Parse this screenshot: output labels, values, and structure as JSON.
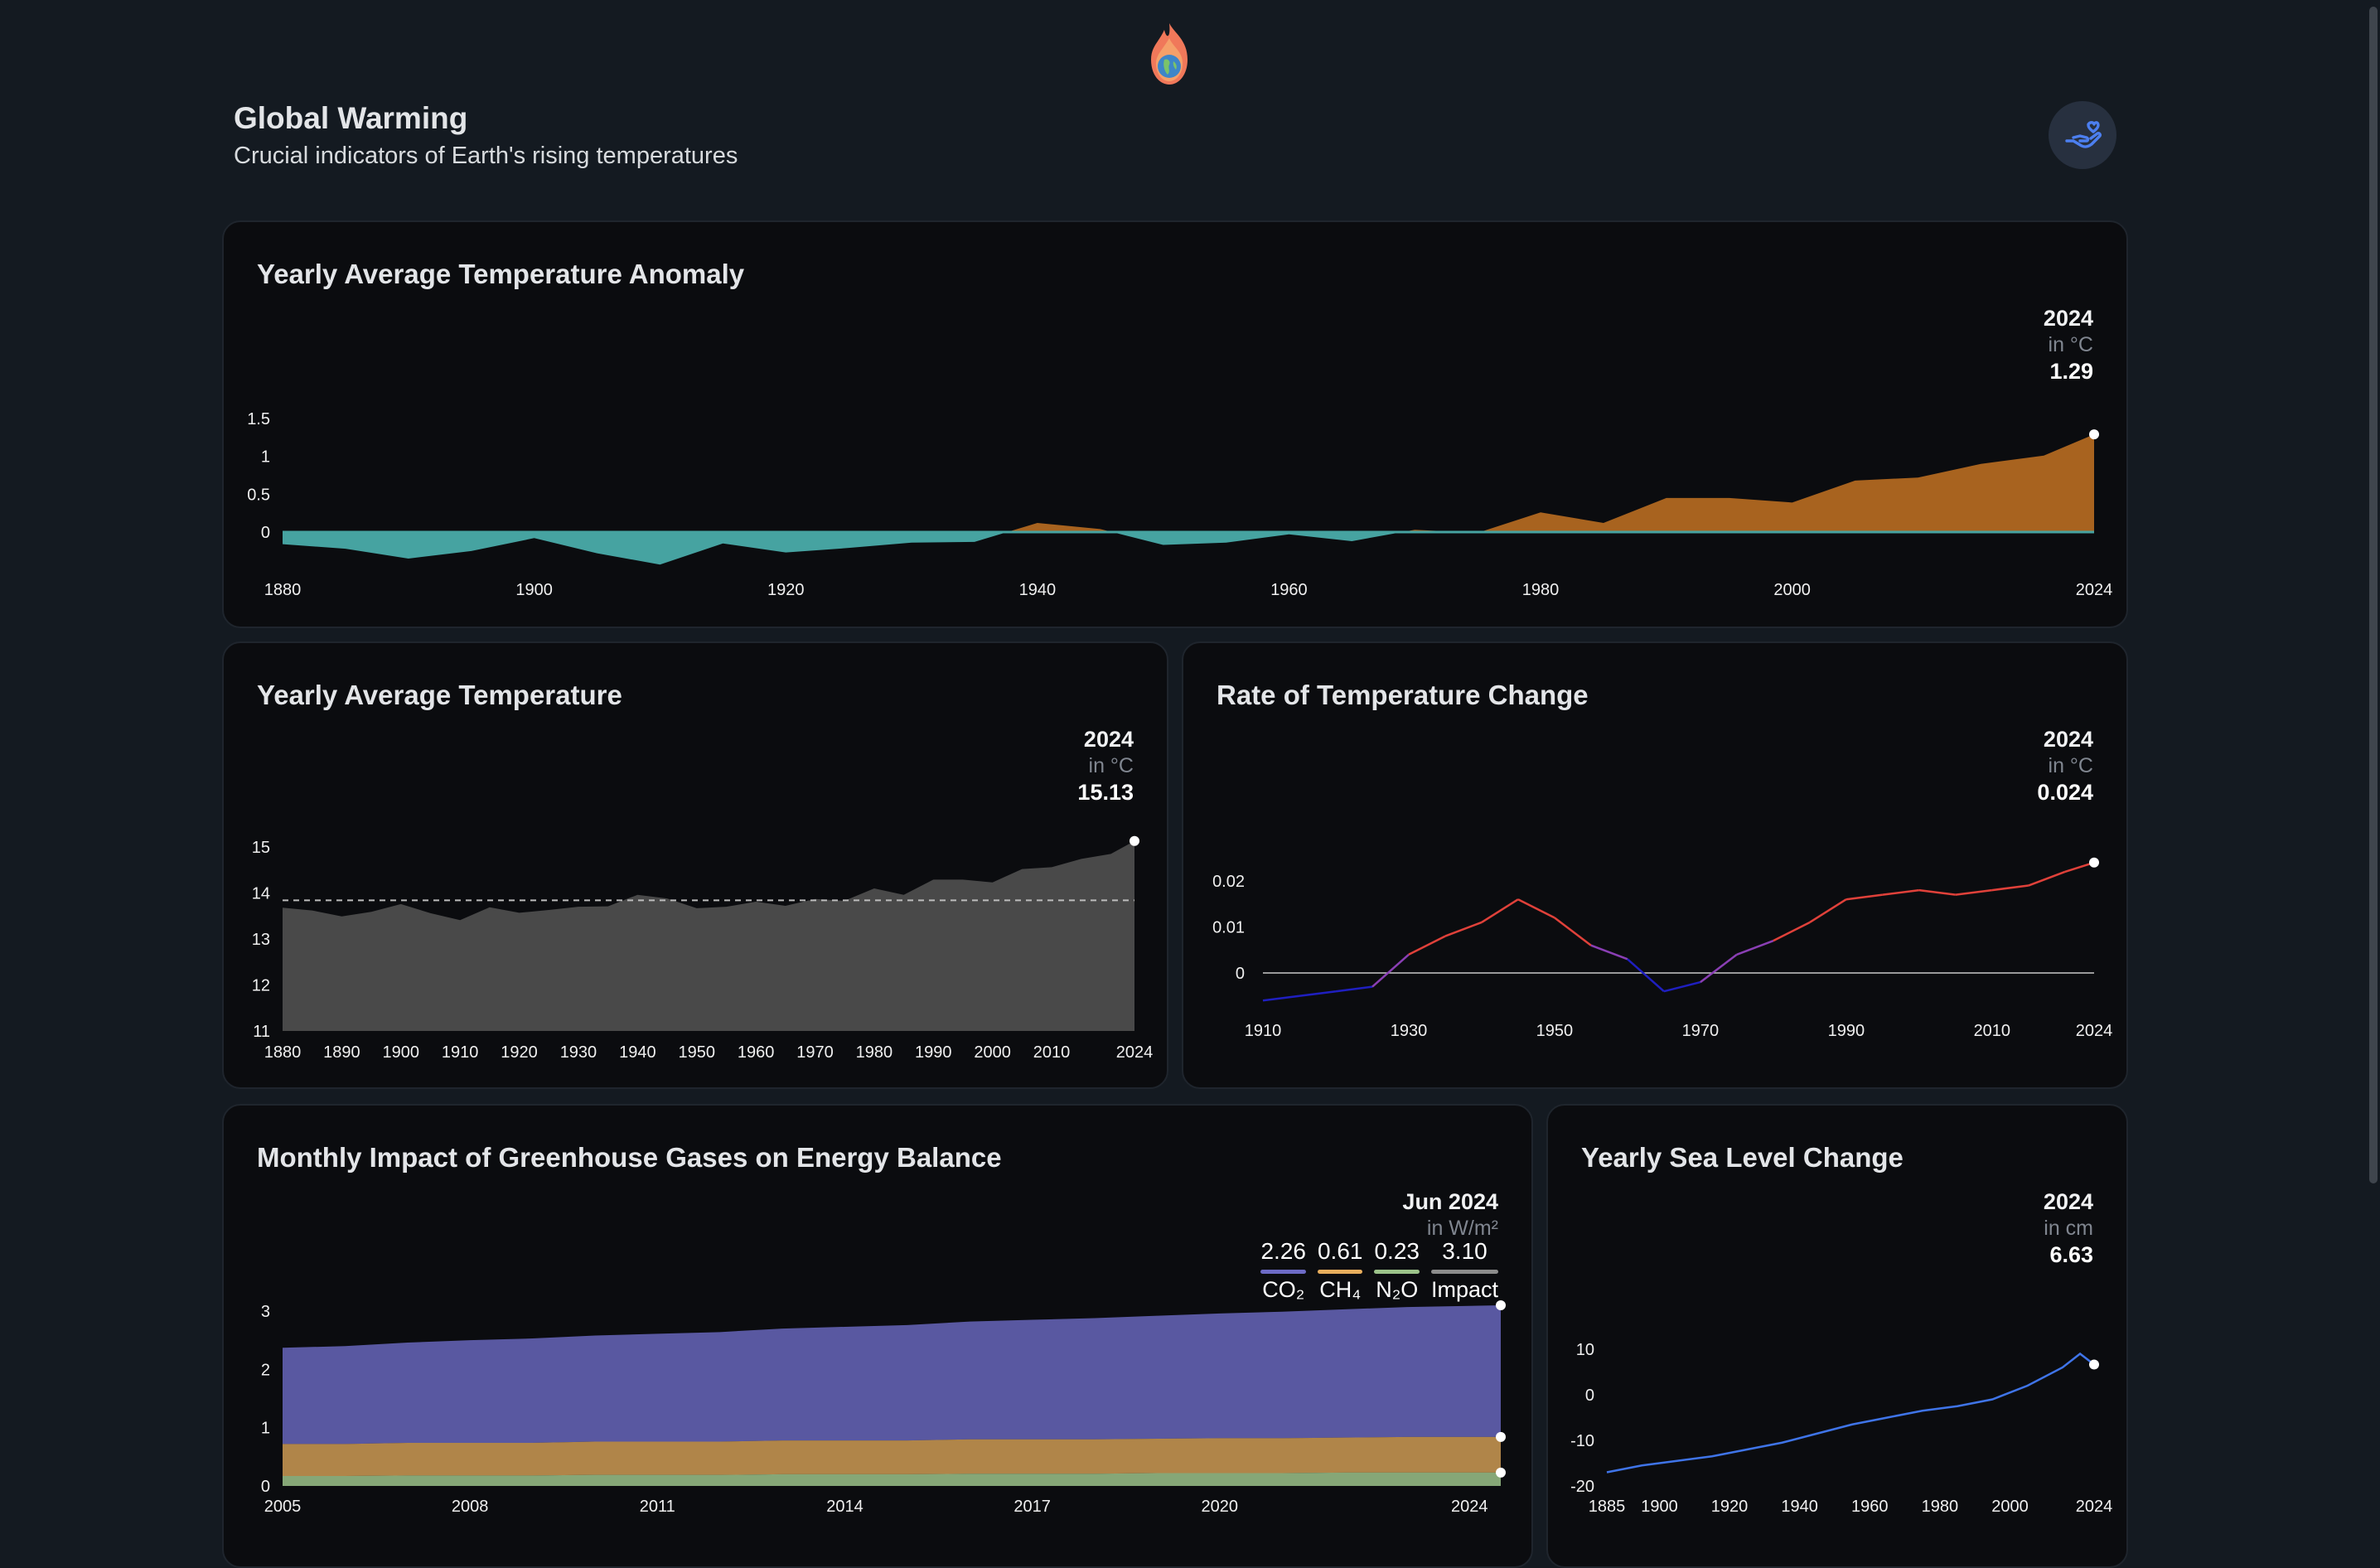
{
  "header": {
    "title": "Global Warming",
    "subtitle": "Crucial indicators of Earth's rising temperatures",
    "logo_icon": "flaming-earth-icon",
    "donate_icon": "hand-heart-icon"
  },
  "colors": {
    "background": "#141a21",
    "card": "#0b0c0f",
    "negative_anomaly": "#46a3a1",
    "positive_anomaly": "#a8631f",
    "temperature_area": "#494949",
    "rate_cold": "#1f1fc0",
    "rate_hot": "#e0413a",
    "co2": "#6d6bc6",
    "ch4": "#e8ae5d",
    "n2o": "#9cc38a",
    "impact": "#8c8c8c",
    "sea_level": "#3f74e8"
  },
  "anomaly": {
    "title": "Yearly Average Temperature Anomaly",
    "readout": {
      "date": "2024",
      "unit": "in °C",
      "value": "1.29"
    },
    "chart_data": {
      "type": "area",
      "x": [
        1880,
        1885,
        1890,
        1895,
        1900,
        1905,
        1910,
        1915,
        1920,
        1925,
        1930,
        1935,
        1940,
        1945,
        1950,
        1955,
        1960,
        1965,
        1970,
        1975,
        1980,
        1985,
        1990,
        1995,
        2000,
        2005,
        2010,
        2015,
        2020,
        2024
      ],
      "y": [
        -0.16,
        -0.22,
        -0.35,
        -0.25,
        -0.08,
        -0.28,
        -0.43,
        -0.15,
        -0.27,
        -0.21,
        -0.14,
        -0.13,
        0.12,
        0.04,
        -0.17,
        -0.14,
        -0.03,
        -0.12,
        0.03,
        -0.01,
        0.26,
        0.12,
        0.45,
        0.45,
        0.39,
        0.68,
        0.72,
        0.9,
        1.01,
        1.29
      ],
      "yticks": [
        "0",
        "0.5",
        "1",
        "1.5"
      ],
      "xticks": [
        "1880",
        "1900",
        "1920",
        "1940",
        "1960",
        "1980",
        "2000",
        "2024"
      ],
      "ylim": [
        -0.5,
        1.5
      ],
      "grid": false
    }
  },
  "avg_temp": {
    "title": "Yearly Average Temperature",
    "readout": {
      "date": "2024",
      "unit": "in °C",
      "value": "15.13"
    },
    "chart_data": {
      "type": "area",
      "x": [
        1880,
        1885,
        1890,
        1895,
        1900,
        1905,
        1910,
        1915,
        1920,
        1925,
        1930,
        1935,
        1940,
        1945,
        1950,
        1955,
        1960,
        1965,
        1970,
        1975,
        1980,
        1985,
        1990,
        1995,
        2000,
        2005,
        2010,
        2015,
        2020,
        2024
      ],
      "y": [
        13.68,
        13.62,
        13.49,
        13.59,
        13.76,
        13.56,
        13.41,
        13.69,
        13.57,
        13.63,
        13.7,
        13.71,
        13.96,
        13.88,
        13.67,
        13.7,
        13.81,
        13.72,
        13.87,
        13.83,
        14.1,
        13.96,
        14.29,
        14.29,
        14.23,
        14.52,
        14.56,
        14.74,
        14.85,
        15.13
      ],
      "baseline": 13.84,
      "yticks": [
        "11",
        "12",
        "13",
        "14",
        "15"
      ],
      "xticks": [
        "1880",
        "1890",
        "1900",
        "1910",
        "1920",
        "1930",
        "1940",
        "1950",
        "1960",
        "1970",
        "1980",
        "1990",
        "2000",
        "2010",
        "2024"
      ],
      "ylim": [
        11,
        15.5
      ]
    }
  },
  "rate": {
    "title": "Rate of Temperature Change",
    "readout": {
      "date": "2024",
      "unit": "in °C",
      "value": "0.024"
    },
    "chart_data": {
      "type": "line",
      "x": [
        1910,
        1915,
        1920,
        1925,
        1930,
        1935,
        1940,
        1945,
        1950,
        1955,
        1960,
        1965,
        1970,
        1975,
        1980,
        1985,
        1990,
        1995,
        2000,
        2005,
        2010,
        2015,
        2020,
        2024
      ],
      "y": [
        -0.006,
        -0.005,
        -0.004,
        -0.003,
        0.004,
        0.008,
        0.011,
        0.016,
        0.012,
        0.006,
        0.003,
        -0.004,
        -0.002,
        0.004,
        0.007,
        0.011,
        0.016,
        0.017,
        0.018,
        0.017,
        0.018,
        0.019,
        0.022,
        0.024
      ],
      "yticks": [
        "0",
        "0.01",
        "0.02"
      ],
      "xticks": [
        "1910",
        "1930",
        "1950",
        "1970",
        "1990",
        "2010",
        "2024"
      ],
      "ylim": [
        -0.01,
        0.03
      ]
    }
  },
  "ghg": {
    "title": "Monthly Impact of Greenhouse Gases on Energy Balance",
    "readout": {
      "date": "Jun 2024",
      "unit": "in W/m²"
    },
    "legend": [
      {
        "value": "2.26",
        "label": "CO₂",
        "color": "#6d6bc6"
      },
      {
        "value": "0.61",
        "label": "CH₄",
        "color": "#e8ae5d"
      },
      {
        "value": "0.23",
        "label": "N₂O",
        "color": "#9cc38a"
      },
      {
        "value": "3.10",
        "label": "Impact",
        "color": "#8c8c8c"
      }
    ],
    "chart_data": {
      "type": "area",
      "x": [
        2005,
        2006,
        2007,
        2008,
        2009,
        2010,
        2011,
        2012,
        2013,
        2014,
        2015,
        2016,
        2017,
        2018,
        2019,
        2020,
        2021,
        2022,
        2023,
        2024.5
      ],
      "series": [
        {
          "name": "CO₂",
          "values": [
            1.65,
            1.68,
            1.72,
            1.76,
            1.79,
            1.82,
            1.85,
            1.88,
            1.92,
            1.95,
            1.98,
            2.02,
            2.05,
            2.08,
            2.11,
            2.14,
            2.17,
            2.2,
            2.23,
            2.26
          ]
        },
        {
          "name": "CH₄",
          "values": [
            0.55,
            0.55,
            0.56,
            0.56,
            0.56,
            0.57,
            0.57,
            0.57,
            0.58,
            0.58,
            0.58,
            0.59,
            0.59,
            0.59,
            0.59,
            0.6,
            0.6,
            0.6,
            0.61,
            0.61
          ]
        },
        {
          "name": "N₂O",
          "values": [
            0.17,
            0.17,
            0.18,
            0.18,
            0.18,
            0.19,
            0.19,
            0.19,
            0.2,
            0.2,
            0.2,
            0.21,
            0.21,
            0.21,
            0.22,
            0.22,
            0.22,
            0.23,
            0.23,
            0.23
          ]
        }
      ],
      "yticks": [
        "0",
        "1",
        "2",
        "3"
      ],
      "xticks": [
        "2005",
        "2008",
        "2011",
        "2014",
        "2017",
        "2020",
        "2024"
      ],
      "ylim": [
        0,
        3
      ]
    }
  },
  "sea": {
    "title": "Yearly Sea Level Change",
    "readout": {
      "date": "2024",
      "unit": "in cm",
      "value": "6.63"
    },
    "chart_data": {
      "type": "line",
      "x": [
        1885,
        1895,
        1905,
        1915,
        1925,
        1935,
        1945,
        1955,
        1965,
        1975,
        1985,
        1995,
        2005,
        2015,
        2020,
        2024
      ],
      "y": [
        -17,
        -15.5,
        -14.5,
        -13.5,
        -12,
        -10.5,
        -8.5,
        -6.5,
        -5,
        -3.5,
        -2.5,
        -1,
        2,
        6,
        9,
        6.63
      ],
      "yticks": [
        "-20",
        "-10",
        "0",
        "10"
      ],
      "xticks": [
        "1885",
        "1900",
        "1920",
        "1940",
        "1960",
        "1980",
        "2000",
        "2024"
      ],
      "ylim": [
        -20,
        10
      ]
    }
  }
}
